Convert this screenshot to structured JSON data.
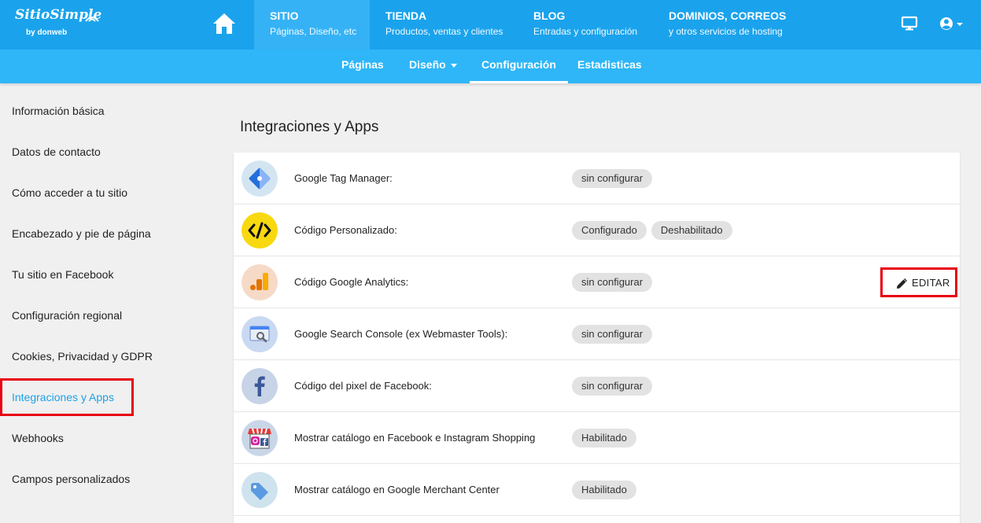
{
  "brand": {
    "name": "SitioSimple",
    "by": "by donweb"
  },
  "top_nav": [
    {
      "title": "SITIO",
      "subtitle": "Páginas, Diseño, etc",
      "active": true
    },
    {
      "title": "TIENDA",
      "subtitle": "Productos, ventas y clientes",
      "active": false
    },
    {
      "title": "BLOG",
      "subtitle": "Entradas y configuración",
      "active": false
    },
    {
      "title": "DOMINIOS, CORREOS",
      "subtitle": "y otros servicios de hosting",
      "active": false
    }
  ],
  "sub_nav": [
    {
      "label": "Páginas"
    },
    {
      "label": "Diseño"
    },
    {
      "label": "Configuración"
    },
    {
      "label": "Estadisticas"
    }
  ],
  "sidebar": {
    "items": [
      {
        "label": "Información básica"
      },
      {
        "label": "Datos de contacto"
      },
      {
        "label": "Cómo acceder a tu sitio"
      },
      {
        "label": "Encabezado y pie de página"
      },
      {
        "label": "Tu sitio en Facebook"
      },
      {
        "label": "Configuración regional"
      },
      {
        "label": "Cookies, Privacidad y GDPR"
      },
      {
        "label": "Integraciones y Apps"
      },
      {
        "label": "Webhooks"
      },
      {
        "label": "Campos personalizados"
      }
    ],
    "active_index": 7
  },
  "main": {
    "title": "Integraciones y Apps",
    "edit_label": "EDITAR",
    "rows": [
      {
        "icon": "google-tag-manager-icon",
        "label": "Google Tag Manager:",
        "badges": [
          "sin configurar"
        ]
      },
      {
        "icon": "code-icon",
        "label": "Código Personalizado:",
        "badges": [
          "Configurado",
          "Deshabilitado"
        ]
      },
      {
        "icon": "google-analytics-icon",
        "label": "Código Google Analytics:",
        "badges": [
          "sin configurar"
        ]
      },
      {
        "icon": "search-console-icon",
        "label": "Google Search Console (ex Webmaster Tools):",
        "badges": [
          "sin configurar"
        ]
      },
      {
        "icon": "facebook-icon",
        "label": "Código del pixel de Facebook:",
        "badges": [
          "sin configurar"
        ]
      },
      {
        "icon": "shop-catalog-icon",
        "label": "Mostrar catálogo en Facebook e Instagram Shopping",
        "badges": [
          "Habilitado"
        ]
      },
      {
        "icon": "price-tag-icon",
        "label": "Mostrar catálogo en Google Merchant Center",
        "badges": [
          "Habilitado"
        ]
      }
    ]
  },
  "colors": {
    "topbar": "#1aa3ec",
    "subbar": "#2eb6f8",
    "active_link": "#1da1e8",
    "highlight": "#e8000e"
  }
}
